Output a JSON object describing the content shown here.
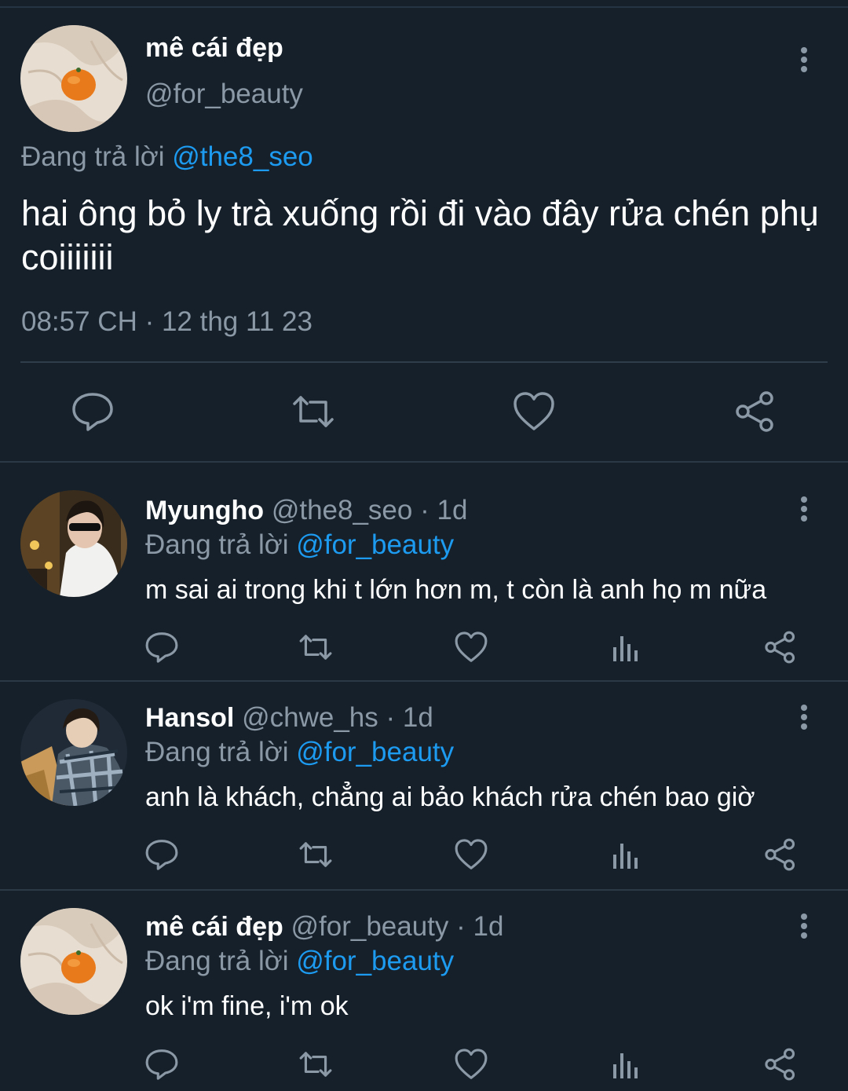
{
  "main_tweet": {
    "author_name": "mê cái đẹp",
    "author_handle": "@for_beauty",
    "replying_prefix": "Đang trả lời",
    "replying_to": "@the8_seo",
    "text": "hai ông bỏ ly trà xuống rồi đi vào đây rửa chén phụ coiiiiiii",
    "timestamp": "08:57 CH · 12 thg 11 23",
    "actions": [
      "reply-icon",
      "retweet-icon",
      "like-icon",
      "share-icon"
    ]
  },
  "replies": [
    {
      "name": "Myungho",
      "handle": "@the8_seo",
      "sep": "·",
      "time": "1d",
      "replying_prefix": "Đang trả lời",
      "replying_to": "@for_beauty",
      "text": "m sai ai trong khi t lớn hơn m, t còn là anh họ m nữa"
    },
    {
      "name": "Hansol",
      "handle": "@chwe_hs",
      "sep": "·",
      "time": "1d",
      "replying_prefix": "Đang trả lời",
      "replying_to": "@for_beauty",
      "text": "anh là khách, chẳng ai bảo khách rửa chén bao giờ"
    },
    {
      "name": "mê cái đẹp",
      "handle": "@for_beauty",
      "sep": "·",
      "time": "1d",
      "replying_prefix": "Đang trả lời",
      "replying_to": "@for_beauty",
      "text": "ok i'm fine, i'm ok"
    }
  ],
  "colors": {
    "background": "#15202b",
    "secondary_text": "#8b98a5",
    "mention": "#1d9bf0",
    "icon": "#8b98a5"
  }
}
